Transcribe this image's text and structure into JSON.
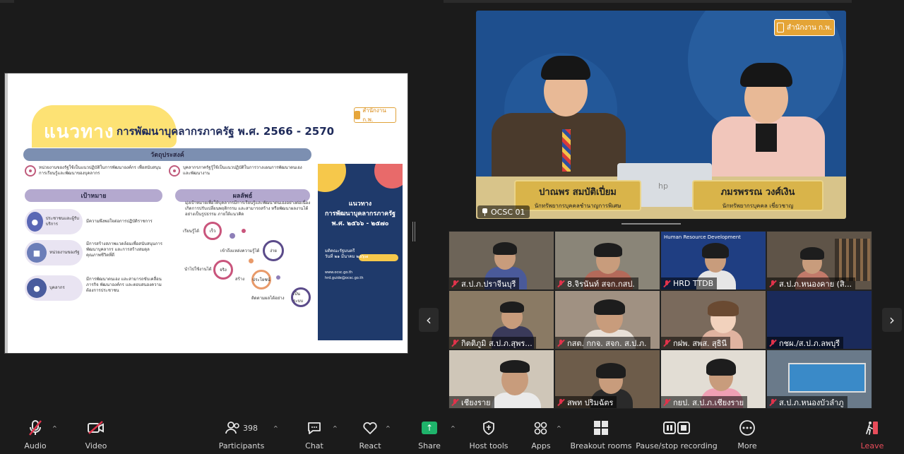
{
  "slide": {
    "title_main": "แนวทาง",
    "title_sub": "การพัฒนาบุคลากรภาครัฐ  พ.ศ. 2566 - 2570",
    "logo_text": "สำนักงาน ก.พ.",
    "objective_label": "วัตถุประสงค์",
    "objective_1": "หน่วยงานของรัฐใช้เป็นแนวปฏิบัติในการพัฒนาองค์กร เพื่อสนับสนุนการเรียนรู้และพัฒนาของบุคลากร",
    "objective_2": "บุคลากรภาครัฐรู้ใช้เป็นแนวปฏิบัติในการวางแผนการพัฒนาตนเอง และพัฒนางาน",
    "goal_label": "เป้าหมาย",
    "result_label": "ผลลัพธ์",
    "result_desc": "มุ่งเป้าหมายเพื่อให้บุคลากรมีการเรียนรู้และพัฒนาตนเองอย่างต่อเนื่อง เกิดการปรับเปลี่ยนพฤติกรรม และสามารถสร้าง หรือพัฒนาผลงานได้ อย่างเป็นรูปธรรม ภายใต้แนวคิด",
    "goals": [
      {
        "label": "ประชาชนและผู้รับบริการ",
        "desc": "มีความพึงพอใจต่อการปฏิบัติราชการ"
      },
      {
        "label": "หน่วยงานของรัฐ",
        "desc": "มีการสร้างสภาพแวดล้อมเพื่อสนับสนุนการพัฒนาบุคลากร และการสร้างสมดุลคุณภาพชีวิตที่ดี"
      },
      {
        "label": "บุคลากร",
        "desc": "มีการพัฒนาตนเอง และสามารถขับเคลื่อนภารกิจ พัฒนาองค์กร และตอบสนองความต้องการประชาชน"
      }
    ],
    "nodes": {
      "learn": "เรียนรู้ได้",
      "fast": "เร็ว",
      "understand": "เข้าถึงแหล่งความรู้ได้",
      "easy": "ง่าย",
      "apply": "นำไปใช้งานได้",
      "real": "จริง",
      "create": "สร้าง",
      "benefit": "ประโยชน์",
      "track": "ติดตามผลได้อย่าง",
      "system": "เป็นระบบ"
    },
    "card": {
      "title_1": "แนวทาง",
      "title_2": "การพัฒนาบุคลากรภาครัฐ",
      "title_3": "พ.ศ. ๒๕๖๖ - ๒๕๗๐",
      "date_1": "มติคณะรัฐมนตรี",
      "date_2": "วันที่ ๒๑ มีนาคม ๒๕๖๗",
      "link_1": "www.ocsc.go.th",
      "link_2": "hrd.guide@ocsc.go.th"
    }
  },
  "speaker": {
    "label": "OCSC 01",
    "logo_text": "สำนักงาน ก.พ.",
    "person_1_name": "ปาณพร สมบัติเปี่ยม",
    "person_1_position": "นักทรัพยากรบุคคลชำนาญการพิเศษ",
    "person_2_name": "ภมรพรรณ วงศ์เงิน",
    "person_2_position": "นักทรัพยากรบุคคล เชี่ยวชาญ",
    "laptop_brand": "hp"
  },
  "gallery": {
    "tiles": [
      {
        "name": "ส.ป.ภ.ปราจีนบุรี"
      },
      {
        "name": "8.จิรนันท์ สจก.กสป."
      },
      {
        "name": "HRD TTDB",
        "banner": "Human Resource Development"
      },
      {
        "name": "ส.ป.ภ.หนองคาย (สิ..."
      },
      {
        "name": "กิตติภูมิ ส.ป.ภ.สุพร..."
      },
      {
        "name": "กสต. กกจ. สจก. ส.ป.ภ."
      },
      {
        "name": "กฝพ. สพส. สุธินี"
      },
      {
        "name": "กชผ./ส.ป.ภ.ลพบุรี"
      },
      {
        "name": "เชียงราย"
      },
      {
        "name": "สพท ปริมฉัตร"
      },
      {
        "name": "กยป. ส.ป.ภ.เชียงราย"
      },
      {
        "name": "ส.ป.ภ.หนองบัวลำภู"
      }
    ]
  },
  "toolbar": {
    "audio": "Audio",
    "video": "Video",
    "participants": "Participants",
    "participants_count": "398",
    "chat": "Chat",
    "react": "React",
    "share": "Share",
    "host_tools": "Host tools",
    "apps": "Apps",
    "breakout": "Breakout rooms",
    "recording": "Pause/stop recording",
    "more": "More",
    "leave": "Leave"
  },
  "colors": {
    "share_green": "#1fb36b",
    "muted_red": "#e0334b",
    "leave_red": "#e74c5a",
    "slide_yellow": "#fde274",
    "card_navy": "#1f3a6b"
  }
}
